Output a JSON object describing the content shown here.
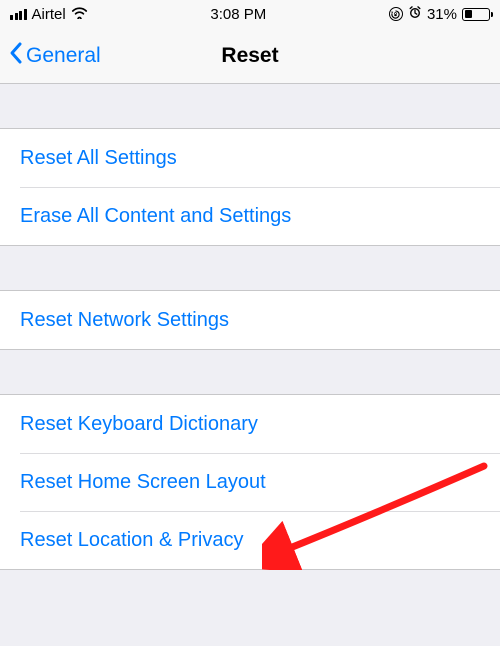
{
  "statusBar": {
    "carrier": "Airtel",
    "time": "3:08 PM",
    "batteryPercent": "31%"
  },
  "nav": {
    "back": "General",
    "title": "Reset"
  },
  "group1": {
    "item0": "Reset All Settings",
    "item1": "Erase All Content and Settings"
  },
  "group2": {
    "item0": "Reset Network Settings"
  },
  "group3": {
    "item0": "Reset Keyboard Dictionary",
    "item1": "Reset Home Screen Layout",
    "item2": "Reset Location & Privacy"
  }
}
